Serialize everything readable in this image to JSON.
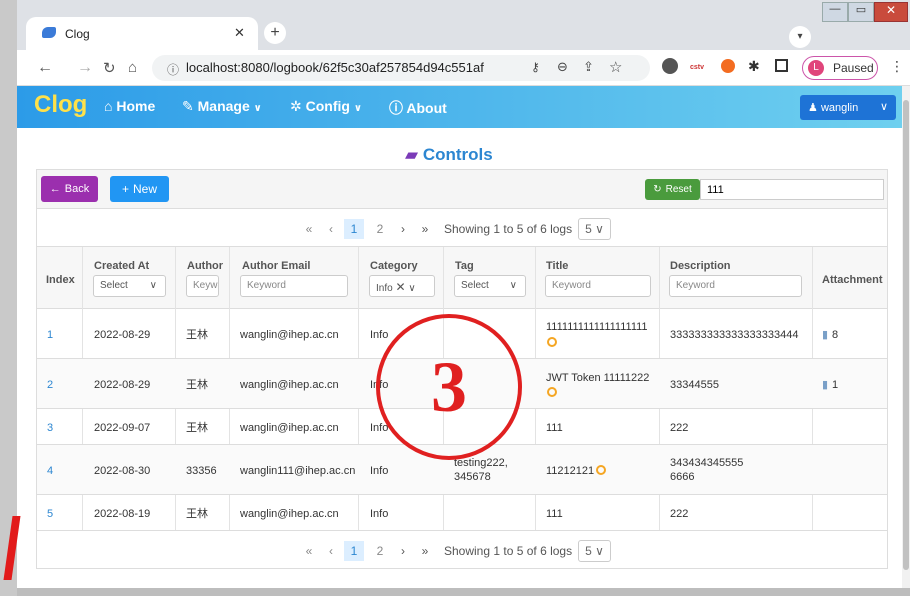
{
  "browser": {
    "tab_title": "Clog",
    "url": "localhost:8080/logbook/62f5c30af257854d94c551af",
    "profile_initial": "L",
    "profile_label": "Paused"
  },
  "navbar": {
    "logo": "Clog",
    "items": [
      "Home",
      "Manage",
      "Config",
      "About"
    ],
    "user": "wanglin"
  },
  "page": {
    "title": "Controls",
    "back_label": "Back",
    "new_label": "New",
    "reset_label": "Reset",
    "search_value": "111"
  },
  "pager": {
    "pages": [
      "1",
      "2"
    ],
    "first": "«",
    "prev": "‹",
    "next": "›",
    "last": "»",
    "summary": "Showing 1 to 5 of 6 logs",
    "page_size": "5"
  },
  "table": {
    "headers": [
      "Index",
      "Created At",
      "Author",
      "Author Email",
      "Category",
      "Tag",
      "Title",
      "Description",
      "Attachment"
    ],
    "filters": {
      "created": "Select",
      "author": "Keywo",
      "email": "Keyword",
      "category": "Info",
      "tag": "Select",
      "title": "Keyword",
      "description": "Keyword"
    },
    "rows": [
      {
        "index": "1",
        "created": "2022-08-29",
        "author": "王林",
        "email": "wanglin@ihep.ac.cn",
        "category": "Info",
        "tag": "",
        "title": "1111111111111111111",
        "description": "333333333333333333444",
        "attachment": "8"
      },
      {
        "index": "2",
        "created": "2022-08-29",
        "author": "王林",
        "email": "wanglin@ihep.ac.cn",
        "category": "Info",
        "tag": "",
        "title": "JWT Token 11111222",
        "description": "33344555",
        "attachment": "1"
      },
      {
        "index": "3",
        "created": "2022-09-07",
        "author": "王林",
        "email": "wanglin@ihep.ac.cn",
        "category": "Info",
        "tag": "",
        "title": "111",
        "description": "222",
        "attachment": ""
      },
      {
        "index": "4",
        "created": "2022-08-30",
        "author": "33356",
        "email": "wanglin111@ihep.ac.cn",
        "category": "Info",
        "tag": "testing222,\n345678",
        "title": "11212121",
        "description": "343434345555\n6666",
        "attachment": ""
      },
      {
        "index": "5",
        "created": "2022-08-19",
        "author": "王林",
        "email": "wanglin@ihep.ac.cn",
        "category": "Info",
        "tag": "",
        "title": "111",
        "description": "222",
        "attachment": ""
      }
    ]
  },
  "annotation": {
    "label": "3"
  },
  "colors": {
    "nav": "#2c9be8",
    "back": "#9b2fae",
    "new": "#2196f3",
    "reset": "#4a9b3d",
    "annotation": "#e02020",
    "title": "#2c86d1"
  }
}
